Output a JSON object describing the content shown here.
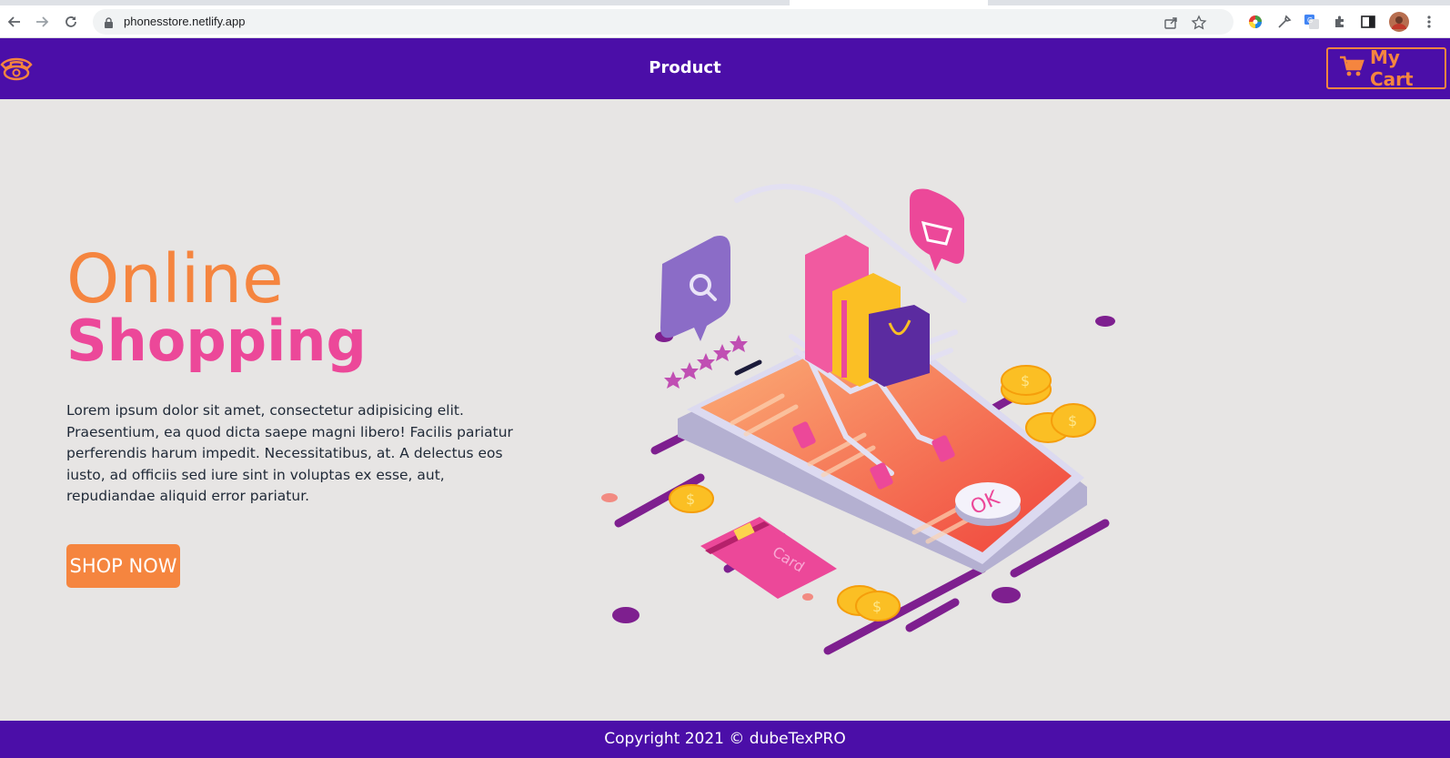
{
  "browser": {
    "url": "phonesstore.netlify.app",
    "icons": [
      "back-icon",
      "forward-icon",
      "reload-icon",
      "lock-icon",
      "share-icon",
      "star-icon",
      "color-picker-ext-icon",
      "eyedropper-ext-icon",
      "translate-ext-icon",
      "extensions-icon",
      "side-panel-icon",
      "profile-avatar",
      "menu-icon"
    ]
  },
  "header": {
    "logo_icon": "phone-icon",
    "nav_product": "Product",
    "cart_label": "My Cart",
    "cart_icon": "cart-icon"
  },
  "hero": {
    "title_line1": "Online",
    "title_line2": "Shopping",
    "body": "Lorem ipsum dolor sit amet, consectetur adipisicing elit. Praesentium, ea quod dicta saepe magni libero! Facilis pariatur perferendis harum impedit. Necessitatibus, at. A delectus eos iusto, ad officiis sed iure sint in voluptas ex esse, aut, repudiandae aliquid error pariatur.",
    "button_label": "SHOP NOW",
    "illustration_texts": {
      "ok": "OK",
      "card": "Card",
      "dollar": "$"
    }
  },
  "footer": {
    "copyright": "Copyright 2021 © dubeTexPRO"
  },
  "colors": {
    "brand_purple": "#4b0ea8",
    "accent_orange": "#f5853f",
    "accent_pink": "#ec4899",
    "page_bg": "#e7e5e4"
  }
}
